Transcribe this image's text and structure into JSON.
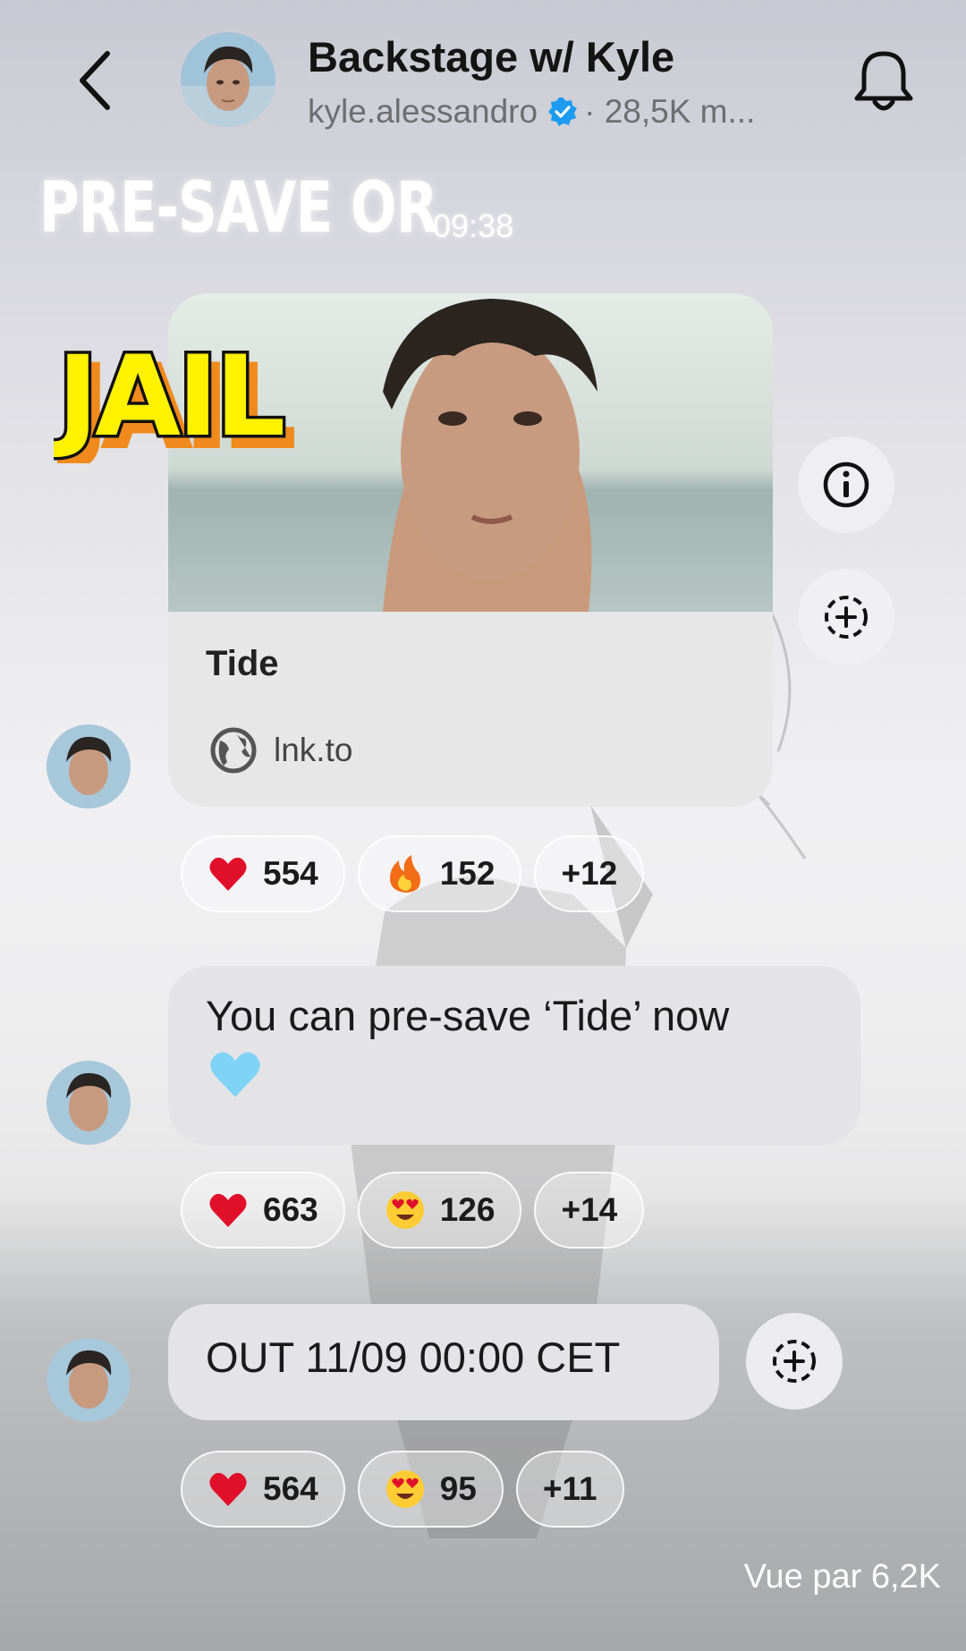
{
  "header": {
    "title": "Backstage w/ Kyle",
    "username": "kyle.alessandro",
    "members": "· 28,5K m..."
  },
  "story_stickers": {
    "pre_save": "PRE-SAVE OR",
    "time": "09:38",
    "jail": "JAIL"
  },
  "messages": [
    {
      "type": "link",
      "title": "Tide",
      "domain": "lnk.to",
      "reactions": [
        {
          "emoji": "heart",
          "count": "554"
        },
        {
          "emoji": "fire",
          "count": "152"
        },
        {
          "emoji": "",
          "count": "+12"
        }
      ]
    },
    {
      "type": "text",
      "text": "You can pre-save ‘Tide’ now",
      "emoji": "light-blue-heart",
      "reactions": [
        {
          "emoji": "heart",
          "count": "663"
        },
        {
          "emoji": "heart-eyes",
          "count": "126"
        },
        {
          "emoji": "",
          "count": "+14"
        }
      ]
    },
    {
      "type": "text",
      "text": "OUT 11/09 00:00 CET",
      "reactions": [
        {
          "emoji": "heart",
          "count": "564"
        },
        {
          "emoji": "heart-eyes",
          "count": "95"
        },
        {
          "emoji": "",
          "count": "+11"
        }
      ]
    }
  ],
  "seen_by": "Vue par 6,2K",
  "colors": {
    "verified": "#1d9bf0",
    "heart": "#e0102b",
    "jail_fill": "#fff200",
    "jail_shadow": "#f08a1c"
  }
}
